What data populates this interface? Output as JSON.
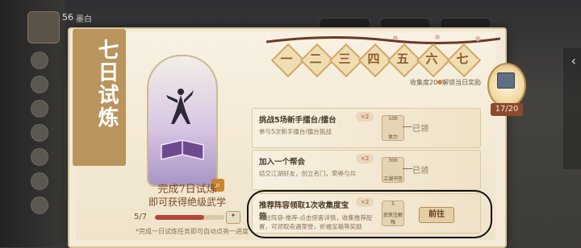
{
  "player": {
    "level": "56",
    "name": "墨白"
  },
  "event": {
    "banner_title": "七日试炼",
    "headline_line1": "完成7日试炼",
    "headline_line2": "即可获得绝级武学",
    "progress_current": 5,
    "progress_total": 7,
    "progress_text": "5/7",
    "progress_end_label": "",
    "note": "*完成一日试炼任务即可自动点亮一进度"
  },
  "days": [
    "一",
    "二",
    "三",
    "四",
    "五",
    "六",
    "七"
  ],
  "collect": {
    "label": "收集度20",
    "unlock_label": "解锁当日奖励"
  },
  "medal": {
    "count": "17/20"
  },
  "tasks": [
    {
      "title": "挑战5场新手擂台/擂台",
      "desc": "参与5次新手擂台/擂台挑战",
      "x_label": "×2",
      "reward_num": "100",
      "reward_label": "体力",
      "status": "已领"
    },
    {
      "title": "加入一个帮会",
      "desc": "结交江湖好友，创立名门，荣辱与共",
      "x_label": "×2",
      "reward_num": "300",
      "reward_label": "江湖书签",
      "status": "已领"
    },
    {
      "title": "推荐阵容领取1次收集度宝箱",
      "desc": "前往阵容-推荐-点击侠客详情，收集推荐配置，可领取奇遇荣誉，祈福宝箱等奖励",
      "x_label": "×2",
      "reward_num": "5",
      "reward_label": "武侠注解 残",
      "status": "前往"
    }
  ],
  "colors": {
    "accent": "#b4483a",
    "brown": "#7e4a2a",
    "gold": "#d1a968"
  }
}
